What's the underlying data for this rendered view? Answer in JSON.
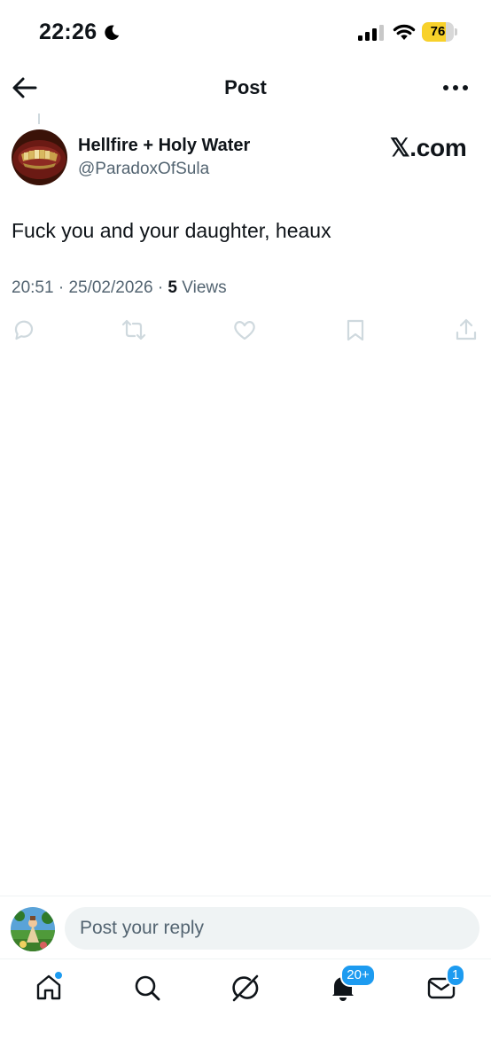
{
  "status_bar": {
    "time": "22:26",
    "battery_level": "76",
    "battery_fraction": 0.76,
    "icons": [
      "moon-icon",
      "signal-icon",
      "wifi-icon",
      "battery-icon"
    ]
  },
  "header": {
    "title": "Post",
    "back_icon": "arrow-left-icon",
    "more_icon": "more-horizontal-icon"
  },
  "post": {
    "author_name": "Hellfire + Holy Water",
    "author_handle": "@ParadoxOfSula",
    "watermark": "𝕏.com",
    "text": "Fuck you and your daughter, heaux",
    "time": "20:51",
    "date": "25/02/2026",
    "separator": "·",
    "views_count": "5",
    "views_label": "Views",
    "actions": [
      "reply-icon",
      "repost-icon",
      "like-icon",
      "bookmark-icon",
      "share-icon"
    ]
  },
  "reply": {
    "placeholder": "Post your reply"
  },
  "bottom_nav": {
    "items": [
      "home-icon",
      "search-icon",
      "grok-icon",
      "notifications-icon",
      "messages-icon"
    ],
    "notifications_badge": "20+",
    "messages_badge": "1"
  },
  "colors": {
    "text": "#0f1419",
    "secondary": "#536471",
    "action_icon": "#cfd9de",
    "accent": "#1d9bf0",
    "battery": "#f8d12a"
  }
}
